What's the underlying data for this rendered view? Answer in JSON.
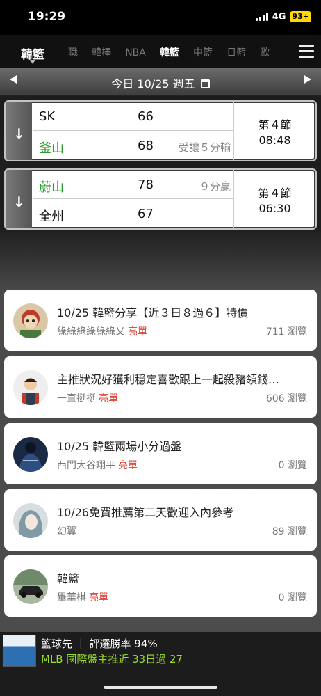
{
  "status_bar": {
    "time": "19:29",
    "network": "4G",
    "battery": "93+"
  },
  "sport_nav": {
    "current": "韓籃",
    "tabs": [
      "職",
      "韓棒",
      "NBA",
      "韓籃",
      "中籃",
      "日籃",
      "歐"
    ],
    "active_tab": "韓籃"
  },
  "date_bar": {
    "date_text": "今日 10/25 週五"
  },
  "games": [
    {
      "team1": {
        "name": "SK",
        "score": "66",
        "note": "",
        "color": "#111111"
      },
      "team2": {
        "name": "釜山",
        "score": "68",
        "note": "受讓５分輸",
        "color": "#2e9b2e"
      },
      "period": "第４節",
      "clock": "08:48"
    },
    {
      "team1": {
        "name": "蔚山",
        "score": "78",
        "note": "９分贏",
        "color": "#2e9b2e"
      },
      "team2": {
        "name": "全州",
        "score": "67",
        "note": "",
        "color": "#111111"
      },
      "period": "第４節",
      "clock": "06:30"
    }
  ],
  "posts": [
    {
      "title": "10/25 韓籃分享【近３日８過６】特價",
      "author": "綠綠綠綠綠綠乂",
      "tag": "亮單",
      "views": "711 瀏覽",
      "avatar": "cartoon-character-avatar"
    },
    {
      "title": "主推狀況好獲利穩定喜歡跟上一起殺豬領錢…",
      "author": "一直挺挺",
      "tag": "亮單",
      "views": "606 瀏覽",
      "avatar": "child-photo-avatar"
    },
    {
      "title": "10/25 韓籃兩場小分過盤",
      "author": "西門大谷翔平",
      "tag": "亮單",
      "views": "0 瀏覽",
      "avatar": "jacket-photo-avatar"
    },
    {
      "title": "10/26免費推薦第二天歡迎入內參考",
      "author": "幻翼",
      "tag": "",
      "views": "89 瀏覽",
      "avatar": "portrait-photo-avatar"
    },
    {
      "title": "韓籃",
      "author": "畢華棋",
      "tag": "亮單",
      "views": "0 瀏覽",
      "avatar": "car-photo-avatar"
    }
  ],
  "ad": {
    "line1": "籃球先 ｜ 評選勝率 94%",
    "line2": "MLB 國際盤主推近 33日過 27",
    "line2_color": "#9bdc2c"
  }
}
